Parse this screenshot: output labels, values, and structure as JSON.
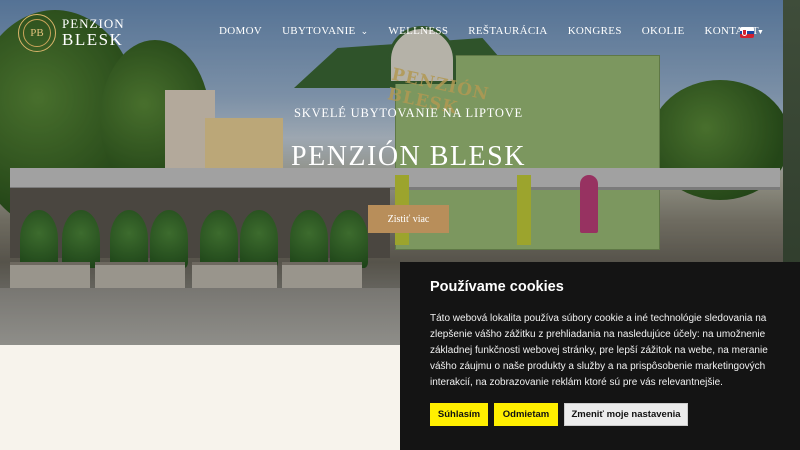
{
  "brand": {
    "badge": "PB",
    "line1": "PENZION",
    "line2": "BLESK"
  },
  "nav": {
    "items": [
      {
        "label": "DOMOV"
      },
      {
        "label": "UBYTOVANIE",
        "has_dropdown": true
      },
      {
        "label": "WELLNESS"
      },
      {
        "label": "REŠTAURÁCIA"
      },
      {
        "label": "KONGRES"
      },
      {
        "label": "OKOLIE"
      },
      {
        "label": "KONTAKT"
      }
    ],
    "language_flag": "slovak-flag-icon"
  },
  "hero": {
    "tagline": "SKVELÉ UBYTOVANIE NA LIPTOVE",
    "title": "PENZIÓN BLESK",
    "cta_label": "Zistiť viac",
    "sign_text": "PENZIÓN BLESK"
  },
  "cookie": {
    "title": "Používame cookies",
    "text": "Táto webová lokalita používa súbory cookie a iné technológie sledovania na zlepšenie vášho zážitku z prehliadania na nasledujúce účely: na umožnenie základnej funkčnosti webovej stránky, pre lepší zážitok na webe, na meranie vášho záujmu o naše produkty a služby a na prispôsobenie marketingových interakcií, na zobrazovanie reklám ktoré sú pre vás relevantnejšie.",
    "accept_label": "Súhlasím",
    "reject_label": "Odmietam",
    "settings_label": "Zmeniť moje nastavenia"
  },
  "colors": {
    "accent_gold": "#b88e5a",
    "cookie_bg": "#141414",
    "button_yellow": "#ffef00"
  }
}
